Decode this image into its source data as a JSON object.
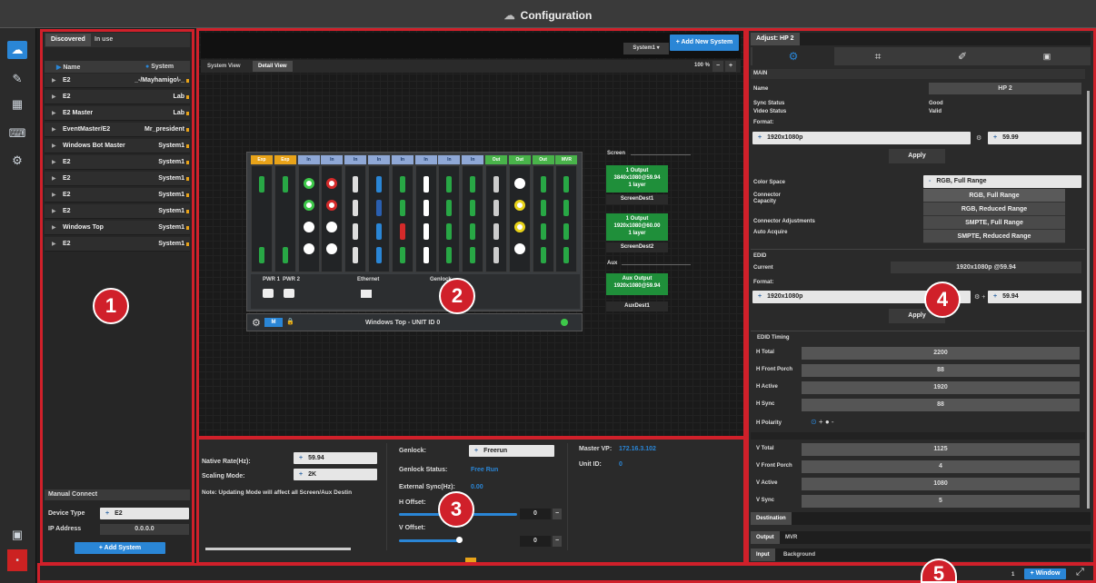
{
  "window": {
    "title": "Configuration"
  },
  "left_panel": {
    "tabs": [
      "Discovered",
      "In use"
    ],
    "columns": {
      "name": "Name",
      "system": "System"
    },
    "rows": [
      {
        "name": "E2",
        "system": "_-/Mayhamigo\\-_"
      },
      {
        "name": "E2",
        "system": "Lab"
      },
      {
        "name": "E2 Master",
        "system": "Lab"
      },
      {
        "name": "EventMaster/E2",
        "system": "Mr_president"
      },
      {
        "name": "Windows Bot Master",
        "system": "System1"
      },
      {
        "name": "E2",
        "system": "System1"
      },
      {
        "name": "E2",
        "system": "System1"
      },
      {
        "name": "E2",
        "system": "System1"
      },
      {
        "name": "E2",
        "system": "System1"
      },
      {
        "name": "Windows Top",
        "system": "System1"
      },
      {
        "name": "E2",
        "system": "System1"
      }
    ],
    "manual_connect": {
      "title": "Manual Connect",
      "device_type_label": "Device Type",
      "device_type_value": "E2",
      "ip_label": "IP Address",
      "ip_value": "0.0.0.0",
      "add_button": "+ Add System"
    }
  },
  "center": {
    "system_select": "System1",
    "add_new_system": "+ Add New System",
    "view_tabs": [
      "System View",
      "Detail View"
    ],
    "zoom": "100 %",
    "zoom_minus": "−",
    "zoom_plus": "+",
    "card_headers": [
      "Exp",
      "Exp",
      "In",
      "In",
      "In",
      "In",
      "In",
      "In",
      "In",
      "In",
      "Out",
      "Out",
      "Out",
      "MVR"
    ],
    "power_labels": [
      "PWR 1",
      "PWR 2",
      "Ethernet",
      "Genlock"
    ],
    "unit_bar": {
      "toggle": "M",
      "label": "Windows Top - UNIT ID 0"
    },
    "screen_section": "Screen",
    "screens": [
      {
        "lines": [
          "1 Output",
          "3840x1080@59.94",
          "1 layer"
        ],
        "name": "ScreenDest1"
      },
      {
        "lines": [
          "1 Output",
          "1920x1080@60.00",
          "1 layer"
        ],
        "name": "ScreenDest2"
      }
    ],
    "aux_section": "Aux",
    "aux": {
      "lines": [
        "Aux Output",
        "1920x1080@59.94"
      ],
      "name": "AuxDest1"
    }
  },
  "settings_panel": {
    "native_rate_label": "Native Rate(Hz):",
    "native_rate_value": "59.94",
    "scaling_label": "Scaling Mode:",
    "scaling_value": "2K",
    "note": "Note: Updating Mode will affect all Screen/Aux Destin",
    "genlock_label": "Genlock:",
    "genlock_value": "Freerun",
    "genlock_status_label": "Genlock Status:",
    "genlock_status_value": "Free Run",
    "external_sync_label": "External Sync(Hz):",
    "external_sync_value": "0.00",
    "h_offset_label": "H Offset:",
    "h_offset_value": "0",
    "v_offset_label": "V Offset:",
    "v_offset_value": "0",
    "master_vp_label": "Master VP:",
    "master_vp_value": "172.16.3.102",
    "unit_id_label": "Unit ID:",
    "unit_id_value": "0"
  },
  "adjust": {
    "title": "Adjust: HP 2",
    "icon_tabs": [
      "gear-icon",
      "crop-icon",
      "brush-icon",
      "s-icon"
    ],
    "section_main": "MAIN",
    "name_label": "Name",
    "name_value": "HP 2",
    "sync_status_label": "Sync Status",
    "sync_status_value": "Good",
    "video_status_label": "Video Status",
    "video_status_value": "Valid",
    "format_label": "Format:",
    "format_value": "1920x1080p",
    "rate_value": "59.99",
    "apply": "Apply",
    "color_space_label": "Color Space",
    "color_space_value": "RGB, Full Range",
    "color_space_options": [
      "RGB, Full Range",
      "RGB, Reduced Range",
      "SMPTE, Full Range",
      "SMPTE, Reduced Range"
    ],
    "connector_capacity_label": "Connector Capacity",
    "connector_adjustments_label": "Connector Adjustments",
    "auto_acquire_label": "Auto Acquire",
    "edid_label": "EDID",
    "edid_current_label": "Current",
    "edid_current_value": "1920x1080p @59.94",
    "edid_format_label": "Format:",
    "edid_format_value": "1920x1080p",
    "edid_rate_value": "59.94",
    "edid_apply": "Apply",
    "edid_timing_label": "EDID Timing",
    "timing": [
      {
        "label": "H Total",
        "value": "2200"
      },
      {
        "label": "H Front Porch",
        "value": "88"
      },
      {
        "label": "H Active",
        "value": "1920"
      },
      {
        "label": "H Sync",
        "value": "88"
      }
    ],
    "h_polarity_label": "H Polarity",
    "timing_v": [
      {
        "label": "V Total",
        "value": "1125"
      },
      {
        "label": "V Front Porch",
        "value": "4"
      },
      {
        "label": "V Active",
        "value": "1080"
      },
      {
        "label": "V Sync",
        "value": "5"
      }
    ],
    "destination_tab": "Destination",
    "output_tabs": [
      "Output",
      "MVR"
    ],
    "input_tabs": [
      "Input",
      "Background"
    ]
  },
  "bottom": {
    "count": "1",
    "window_button": "+ Window"
  },
  "badges": [
    "1",
    "2",
    "3",
    "4",
    "5"
  ],
  "colors": {
    "accent_red": "#d0202a",
    "button_blue": "#2a86d6",
    "output_green": "#1f8f3a",
    "exp_header": "#e8a319",
    "in_header": "#8fa8d6",
    "out_header": "#49b34a"
  }
}
